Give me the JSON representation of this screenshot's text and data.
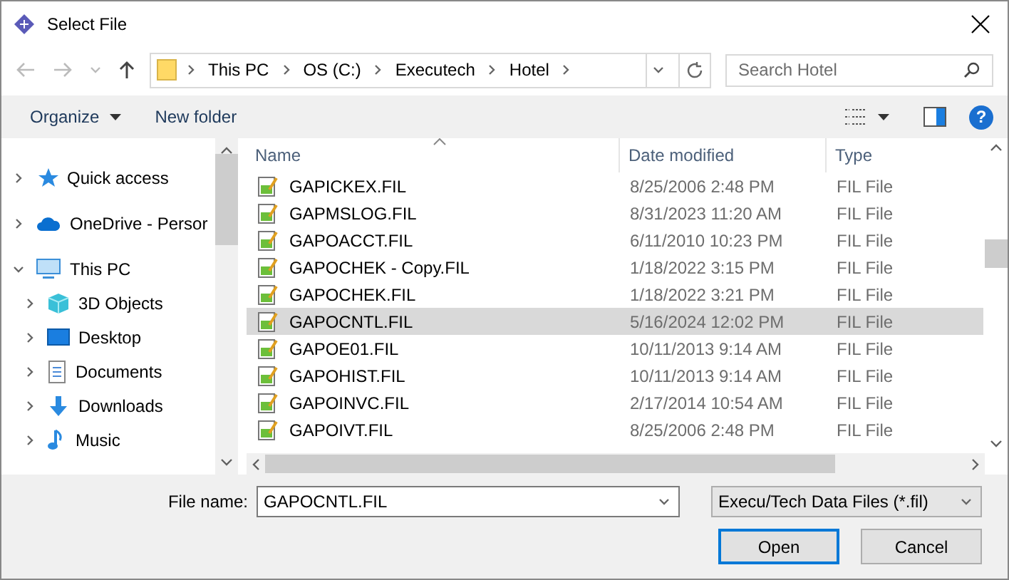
{
  "window": {
    "title": "Select File"
  },
  "address": {
    "breadcrumbs": [
      "This PC",
      "OS (C:)",
      "Executech",
      "Hotel"
    ]
  },
  "search": {
    "placeholder": "Search Hotel"
  },
  "toolbar": {
    "buttons": [
      "Organize",
      "New folder"
    ],
    "help": "?"
  },
  "sidebar": {
    "items": [
      {
        "label": "Quick access",
        "kind": "star",
        "expanded": false
      },
      {
        "label": "OneDrive - Persor",
        "kind": "cloud",
        "expanded": false
      },
      {
        "label": "This PC",
        "kind": "pc",
        "expanded": true,
        "children": [
          {
            "label": "3D Objects",
            "kind": "cube",
            "expanded": false
          },
          {
            "label": "Desktop",
            "kind": "desktop",
            "expanded": false
          },
          {
            "label": "Documents",
            "kind": "document",
            "expanded": false
          },
          {
            "label": "Downloads",
            "kind": "download",
            "expanded": false
          },
          {
            "label": "Music",
            "kind": "music",
            "expanded": false
          }
        ]
      }
    ]
  },
  "table": {
    "columns": [
      {
        "label": "Name",
        "sorted": true
      },
      {
        "label": "Date modified",
        "sorted": false
      },
      {
        "label": "Type",
        "sorted": false
      }
    ],
    "rows": [
      {
        "name": "GAPICKEX.FIL",
        "date": "8/25/2006 2:48 PM",
        "type": "FIL File",
        "selected": false
      },
      {
        "name": "GAPMSLOG.FIL",
        "date": "8/31/2023 11:20 AM",
        "type": "FIL File",
        "selected": false
      },
      {
        "name": "GAPOACCT.FIL",
        "date": "6/11/2010 10:23 PM",
        "type": "FIL File",
        "selected": false
      },
      {
        "name": "GAPOCHEK - Copy.FIL",
        "date": "1/18/2022 3:15 PM",
        "type": "FIL File",
        "selected": false
      },
      {
        "name": "GAPOCHEK.FIL",
        "date": "1/18/2022 3:21 PM",
        "type": "FIL File",
        "selected": false
      },
      {
        "name": "GAPOCNTL.FIL",
        "date": "5/16/2024 12:02 PM",
        "type": "FIL File",
        "selected": true
      },
      {
        "name": "GAPOE01.FIL",
        "date": "10/11/2013 9:14 AM",
        "type": "FIL File",
        "selected": false
      },
      {
        "name": "GAPOHIST.FIL",
        "date": "10/11/2013 9:14 AM",
        "type": "FIL File",
        "selected": false
      },
      {
        "name": "GAPOINVC.FIL",
        "date": "2/17/2014 10:54 AM",
        "type": "FIL File",
        "selected": false
      },
      {
        "name": "GAPOIVT.FIL",
        "date": "8/25/2006 2:48 PM",
        "type": "FIL File",
        "selected": false
      }
    ]
  },
  "footer": {
    "file_name": {
      "label": "File name:",
      "value": "GAPOCNTL.FIL"
    },
    "file_type": {
      "value": "Execu/Tech Data Files (*.fil)"
    },
    "buttons": [
      {
        "label": "Open",
        "default": true
      },
      {
        "label": "Cancel",
        "default": false
      }
    ]
  }
}
